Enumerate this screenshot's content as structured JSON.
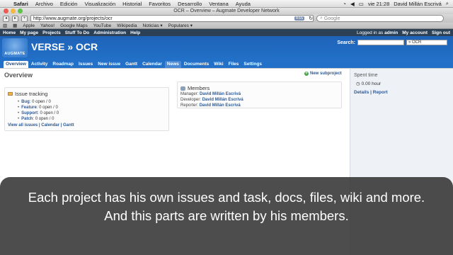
{
  "menubar": {
    "apple_icon": "apple-icon",
    "items": [
      "Safari",
      "Archivo",
      "Edición",
      "Visualización",
      "Historial",
      "Favoritos",
      "Desarrollo",
      "Ventana",
      "Ayuda"
    ],
    "clock": "vie 21:28",
    "user": "David Millán Escrivá"
  },
  "window": {
    "title": "OCR – Overview – Augmate Developer Network"
  },
  "toolbar": {
    "url": "http://www.augmate.org/projects/ocr",
    "rss_label": "RSS",
    "search_placeholder": "Google"
  },
  "bookmarks": [
    "Apple",
    "Yahoo!",
    "Google Maps",
    "YouTube",
    "Wikipedia",
    "Noticias ▾",
    "Populares ▾"
  ],
  "topmenu": {
    "left": [
      "Home",
      "My page",
      "Projects",
      "Stuff To Do",
      "Administration",
      "Help"
    ],
    "logged_in_prefix": "Logged in as",
    "logged_in_user": "admin",
    "my_account": "My account",
    "sign_out": "Sign out"
  },
  "header": {
    "logo_text": "AUGMATE",
    "project_path": "VERSE » OCR",
    "search_label": "Search:",
    "project_select": "» OCR"
  },
  "tabs": [
    {
      "label": "Overview",
      "active": true
    },
    {
      "label": "Activity",
      "active": false
    },
    {
      "label": "Roadmap",
      "active": false
    },
    {
      "label": "Issues",
      "active": false
    },
    {
      "label": "New issue",
      "active": false
    },
    {
      "label": "Gantt",
      "active": false
    },
    {
      "label": "Calendar",
      "active": false
    },
    {
      "label": "News",
      "active": false
    },
    {
      "label": "Documents",
      "active": false
    },
    {
      "label": "Wiki",
      "active": false
    },
    {
      "label": "Files",
      "active": false
    },
    {
      "label": "Settings",
      "active": false
    }
  ],
  "main": {
    "title": "Overview",
    "new_subproject": "New subproject",
    "issue_tracking": {
      "title": "Issue tracking",
      "trackers": [
        {
          "name": "Bug",
          "stats": ": 0 open / 0"
        },
        {
          "name": "Feature",
          "stats": ": 0 open / 0"
        },
        {
          "name": "Support",
          "stats": ": 0 open / 0"
        },
        {
          "name": "Patch",
          "stats": ": 0 open / 0"
        }
      ],
      "footer": "View all issues | Calendar | Gantt"
    },
    "members": {
      "title": "Members",
      "rows": [
        {
          "role": "Manager:",
          "name": "David Millán Escrivá"
        },
        {
          "role": "Developer:",
          "name": "David Millán Escrivá"
        },
        {
          "role": "Reporter:",
          "name": "David Millán Escrivá"
        }
      ]
    }
  },
  "sidebar": {
    "title": "Spent time",
    "hours": "0.00 hour",
    "links": "Details | Report"
  },
  "caption": "Each project has his own issues and task, docs, files, wiki and more. And this parts are written by his members."
}
